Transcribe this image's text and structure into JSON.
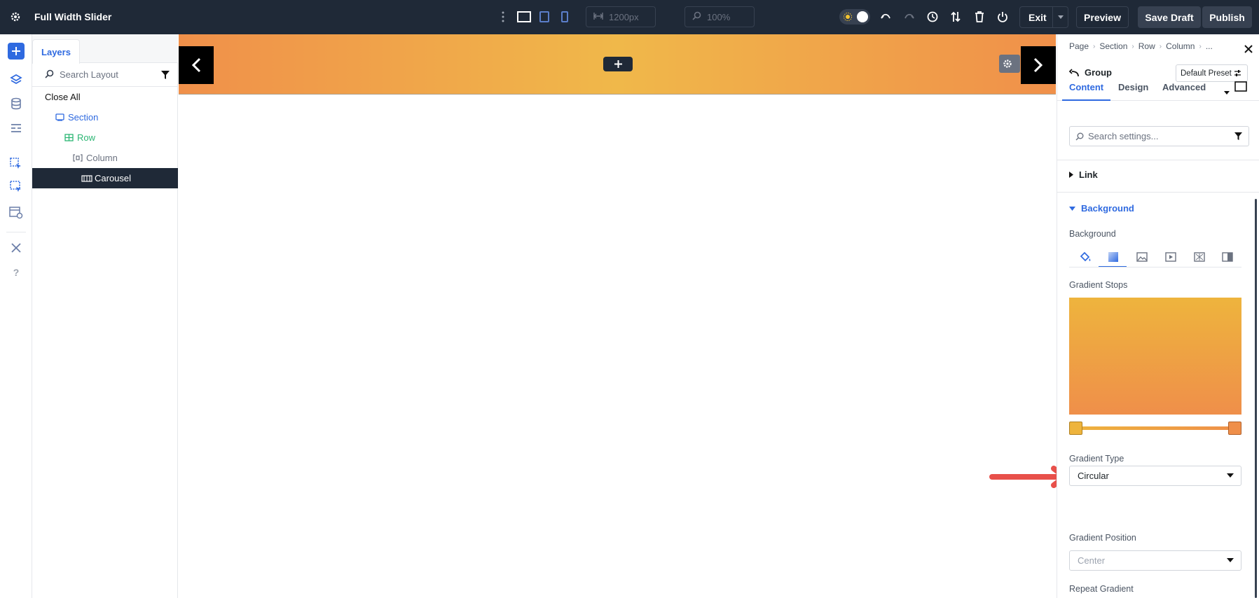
{
  "topbar": {
    "title": "Full Width Slider",
    "width_value": "1200px",
    "zoom_value": "100%",
    "exit_label": "Exit",
    "preview_label": "Preview",
    "save_draft_label": "Save Draft",
    "publish_label": "Publish"
  },
  "layers": {
    "tab_label": "Layers",
    "search_placeholder": "Search Layout",
    "close_all_label": "Close All",
    "tree": [
      {
        "label": "Section",
        "color": "#2f6ae0"
      },
      {
        "label": "Row",
        "color": "#2bb673"
      },
      {
        "label": "Column",
        "color": "#6b7280"
      },
      {
        "label": "Carousel",
        "color": "#ffffff"
      }
    ]
  },
  "panel": {
    "breadcrumb": [
      "Page",
      "Section",
      "Row",
      "Column",
      "..."
    ],
    "group_label": "Group",
    "preset_label": "Default Preset",
    "tabs": [
      "Content",
      "Design",
      "Advanced"
    ],
    "search_placeholder": "Search settings...",
    "link_label": "Link",
    "background_section_label": "Background",
    "background_label": "Background",
    "gradient_stops_label": "Gradient Stops",
    "gradient_type_label": "Gradient Type",
    "gradient_type_value": "Circular",
    "gradient_position_label": "Gradient Position",
    "gradient_position_value": "Center",
    "repeat_gradient_label": "Repeat Gradient"
  },
  "colors": {
    "accent": "#2f6ae0",
    "gradient_start": "#eeb43d",
    "gradient_end": "#ef8f4a",
    "annotation_arrow": "#e8504a"
  }
}
